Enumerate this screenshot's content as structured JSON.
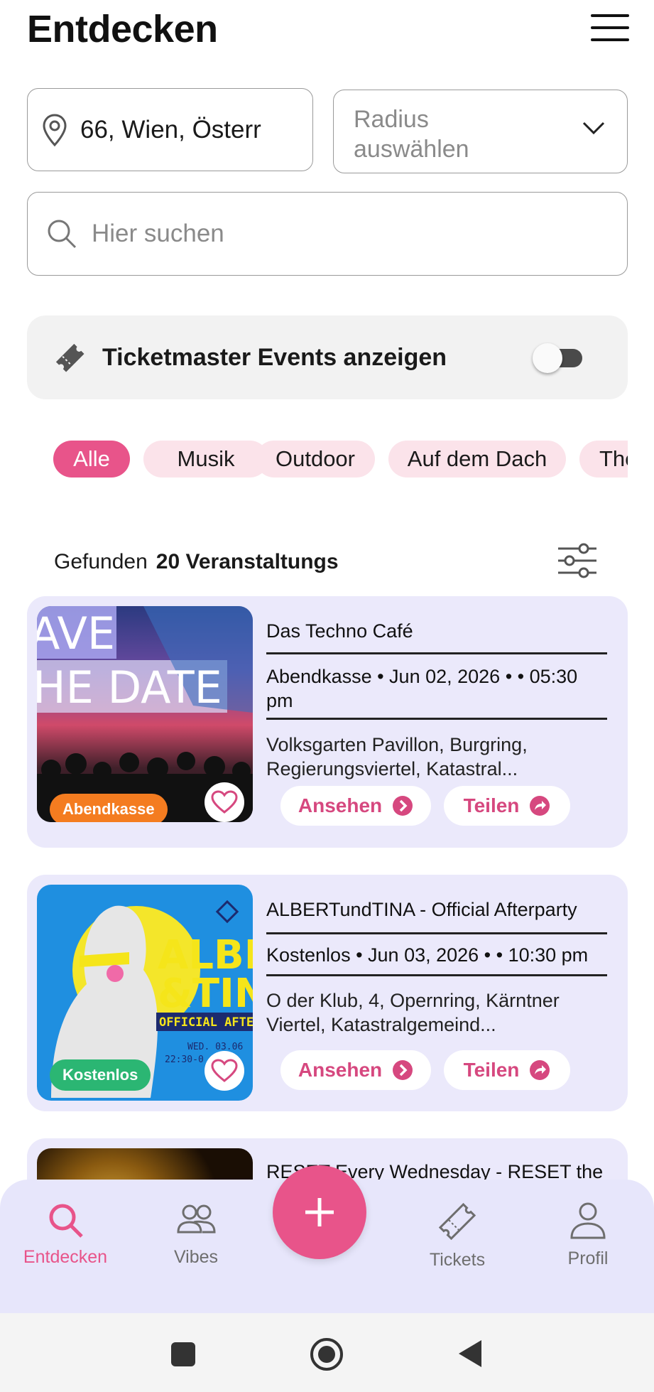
{
  "header": {
    "title": "Entdecken"
  },
  "location": {
    "value": "66, Wien, Österr"
  },
  "radius": {
    "placeholder": "Radius auswählen"
  },
  "search": {
    "placeholder": "Hier suchen"
  },
  "ticketmaster": {
    "label": "Ticketmaster Events anzeigen",
    "enabled": false
  },
  "categories": [
    "Alle",
    "Musik",
    "Outdoor",
    "Auf dem Dach",
    "The"
  ],
  "active_category": "Alle",
  "results": {
    "prefix": "Gefunden",
    "count_text": "20 Veranstaltungs"
  },
  "events": [
    {
      "title": "Das Techno Café",
      "meta": "Abendkasse • Jun 02, 2026 •  • 05:30 pm",
      "address": "Volksgarten Pavillon, Burgring, Regierungsviertel, Katastral...",
      "badge": "Abendkasse",
      "badge_color": "#f47c20",
      "thumb_text_1": "AVE",
      "thumb_text_2": "HE DATE",
      "view_label": "Ansehen",
      "share_label": "Teilen"
    },
    {
      "title": "ALBERTundTINA - Official Afterparty",
      "meta": "Kostenlos • Jun 03, 2026 •  • 10:30 pm",
      "address": "O der Klub, 4, Opernring, Kärntner Viertel, Katastralgemeind...",
      "badge": "Kostenlos",
      "badge_color": "#2bb673",
      "thumb_text_1": "ALBE",
      "thumb_text_2": "&TIN",
      "thumb_text_3": "OFFICIAL AFTE",
      "thumb_text_4": "WED. 03.06",
      "thumb_text_5": "22:30-0",
      "view_label": "Ansehen",
      "share_label": "Teilen"
    },
    {
      "title": "RESET Every Wednesday - RESET the"
    }
  ],
  "bottom_nav": {
    "items": [
      {
        "label": "Entdecken",
        "icon": "search-icon",
        "active": true
      },
      {
        "label": "Vibes",
        "icon": "people-icon",
        "active": false
      },
      {
        "label": "Tickets",
        "icon": "ticket-icon",
        "active": false
      },
      {
        "label": "Profil",
        "icon": "person-icon",
        "active": false
      }
    ],
    "fab_icon": "plus-icon"
  },
  "colors": {
    "accent": "#e8548a",
    "card_bg": "#ebe9fb",
    "nav_bg": "#e7e6fb",
    "chip_bg": "#fbe3ea"
  }
}
